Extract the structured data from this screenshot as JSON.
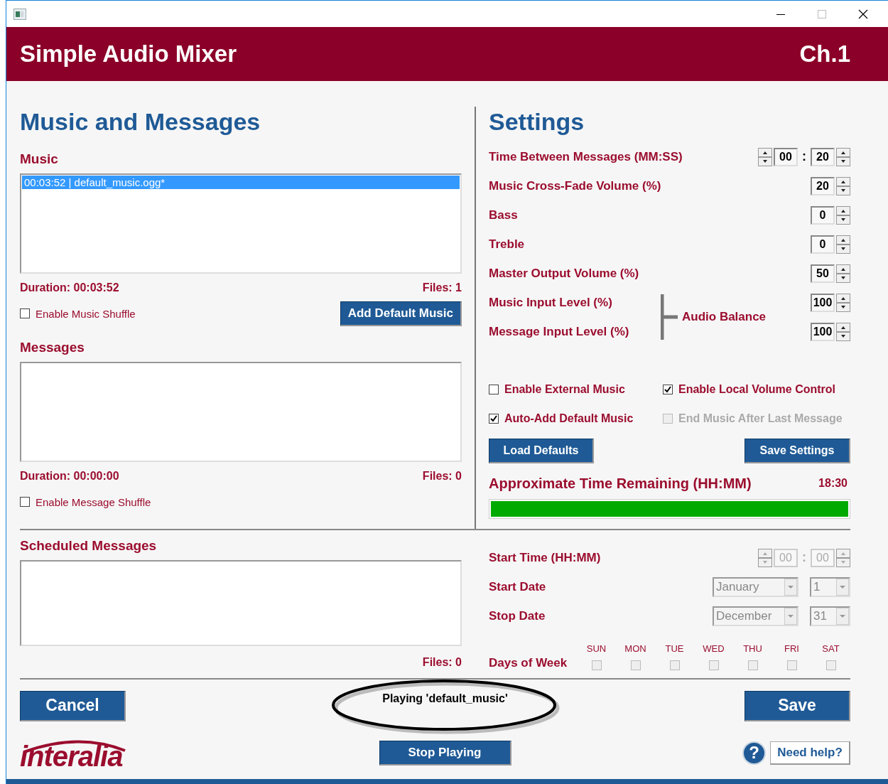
{
  "header": {
    "title": "Simple Audio Mixer",
    "channel": "Ch.1"
  },
  "music_messages": {
    "heading": "Music and Messages",
    "lists": [
      {
        "label": "Music",
        "items": [
          {
            "text": "00:03:52 | default_music.ogg*",
            "selected": true
          }
        ],
        "duration": "Duration: 00:03:52",
        "files": "Files: 1",
        "shuffle": {
          "label": "Enable Music Shuffle",
          "checked": false
        },
        "button": "Add Default Music"
      },
      {
        "label": "Messages",
        "duration": "Duration: 00:00:00",
        "files": "Files: 0",
        "shuffle": {
          "label": "Enable Message Shuffle",
          "checked": false
        }
      }
    ]
  },
  "settings": {
    "heading": "Settings",
    "rows": [
      {
        "kind": "time",
        "label": "Time Between Messages (MM:SS)",
        "values": [
          "00",
          "20"
        ],
        "separator": ":"
      },
      {
        "kind": "spin",
        "label": "Music Cross-Fade Volume (%)",
        "value": "20"
      },
      {
        "kind": "spin",
        "label": "Bass",
        "value": "0"
      },
      {
        "kind": "spin",
        "label": "Treble",
        "value": "0"
      },
      {
        "kind": "spin",
        "label": "Master Output Volume (%)",
        "value": "50"
      }
    ],
    "balance": {
      "label": "Audio Balance",
      "rows": [
        {
          "label": "Music Input Level (%)",
          "value": "100"
        },
        {
          "label": "Message Input Level (%)",
          "value": "100"
        }
      ]
    },
    "options": [
      {
        "label": "Enable External Music",
        "checked": false,
        "disabled": false
      },
      {
        "label": "Enable Local Volume Control",
        "checked": true,
        "disabled": false
      },
      {
        "label": "Auto-Add Default Music",
        "checked": true,
        "disabled": false
      },
      {
        "label": "End Music After Last Message",
        "checked": false,
        "disabled": true
      }
    ],
    "buttons": [
      "Load Defaults",
      "Save Settings"
    ],
    "remaining": {
      "label": "Approximate Time Remaining (HH:MM)",
      "value": "18:30",
      "level": 1.0
    }
  },
  "scheduled": {
    "label": "Scheduled Messages",
    "files": "Files: 0",
    "start_time": {
      "label": "Start Time (HH:MM)",
      "values": [
        "00",
        "00"
      ],
      "separator": ":",
      "disabled": true
    },
    "dates": [
      {
        "label": "Start Date",
        "month": "January",
        "day": "1",
        "disabled": true
      },
      {
        "label": "Stop Date",
        "month": "December",
        "day": "31",
        "disabled": true
      }
    ],
    "days": {
      "label": "Days of Week",
      "items": [
        {
          "label": "SUN",
          "checked": false
        },
        {
          "label": "MON",
          "checked": false
        },
        {
          "label": "TUE",
          "checked": false
        },
        {
          "label": "WED",
          "checked": false
        },
        {
          "label": "THU",
          "checked": false
        },
        {
          "label": "FRI",
          "checked": false
        },
        {
          "label": "SAT",
          "checked": false
        }
      ]
    }
  },
  "footer": {
    "cancel": "Cancel",
    "status": "Playing 'default_music'",
    "save": "Save",
    "stop": "Stop Playing",
    "logo": "interalia",
    "help_icon": "?",
    "help": "Need help?"
  }
}
